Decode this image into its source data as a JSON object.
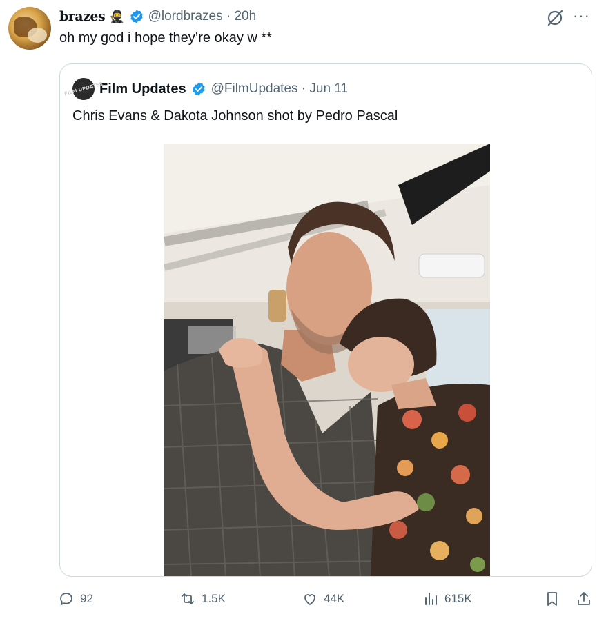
{
  "tweet": {
    "display_name": "brazes",
    "name_emoji": "🥷",
    "handle_time": "@lordbrazes · 20h",
    "text": "oh my god i hope they’re okay w **"
  },
  "quoted": {
    "avatar_text": "FILM UPDATES",
    "display_name": "Film Updates",
    "handle_date": "@FilmUpdates · Jun 11",
    "text": "Chris Evans & Dakota Johnson shot by Pedro Pascal"
  },
  "actions": {
    "replies": "92",
    "reposts": "1.5K",
    "likes": "44K",
    "views": "615K"
  },
  "more_label": "···",
  "colors": {
    "verified": "#1d9bf0",
    "muted": "#536471",
    "border": "#cfd9de"
  },
  "icons": [
    "verified-badge-icon",
    "grok-icon",
    "more-icon",
    "reply-icon",
    "repost-icon",
    "like-icon",
    "views-icon",
    "bookmark-icon",
    "share-icon"
  ]
}
